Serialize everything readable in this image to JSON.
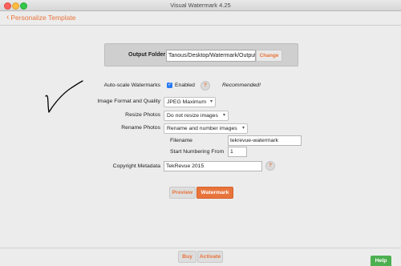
{
  "window": {
    "title": "Visual Watermark 4.25"
  },
  "toolbar": {
    "back_label": "Personalize Template"
  },
  "output": {
    "label": "Output Folder",
    "path": "Tanous/Desktop/Watermark/Output",
    "change_label": "Change"
  },
  "form": {
    "autoscale": {
      "label": "Auto-scale Watermarks",
      "checkbox_label": "Enabled",
      "checked": true,
      "help": "?",
      "note": "Recommended!"
    },
    "format": {
      "label": "Image Format and Quality",
      "value": "JPEG Maximum"
    },
    "resize": {
      "label": "Resize Photos",
      "value": "Do not resize images"
    },
    "rename": {
      "label": "Rename Photos",
      "value": "Rename and number images",
      "filename_label": "Filename",
      "filename_value": "tekrevue-watermark",
      "start_label": "Start Numbering From",
      "start_value": "1"
    },
    "copyright": {
      "label": "Copyright Metadata",
      "value": "TekRevue 2015",
      "help": "?"
    }
  },
  "actions": {
    "preview_label": "Preview",
    "watermark_label": "Watermark"
  },
  "footer": {
    "buy_label": "Buy",
    "activate_label": "Activate",
    "help_label": "Help"
  },
  "colors": {
    "accent": "#e8743b",
    "help_green": "#4caf50",
    "checkbox_blue": "#2a7bf4"
  },
  "icons": {
    "back": "chevron-left-icon",
    "dropdown": "chevron-down-icon",
    "help": "question-icon"
  }
}
